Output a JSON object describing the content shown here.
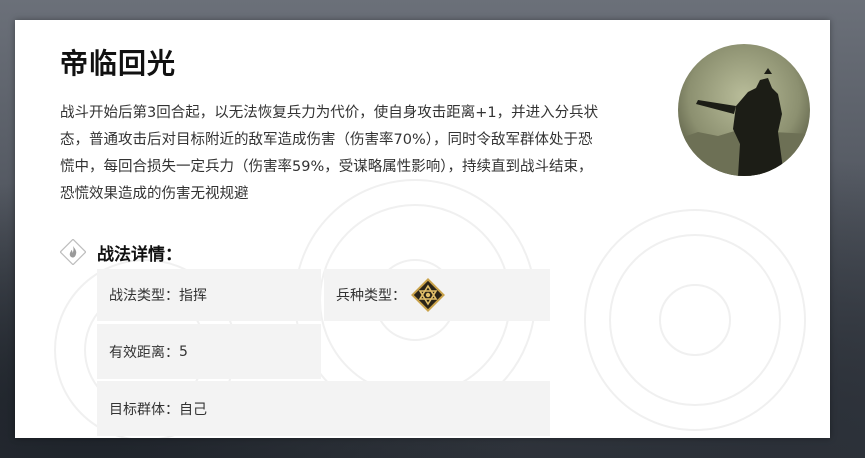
{
  "skill": {
    "name": "帝临回光",
    "description": "战斗开始后第3回合起，以无法恢复兵力为代价，使自身攻击距离+1，并进入分兵状态，普通攻击后对目标附近的敌军造成伤害（伤害率70%），同时令敌军群体处于恐慌中，每回合损失一定兵力（伤害率59%，受谋略属性影响），持续直到战斗结束，恐慌效果造成的伤害无视规避",
    "portrait_icon": "warrior-portrait"
  },
  "details": {
    "heading": "战法详情：",
    "type_label": "战法类型：",
    "type_value": "指挥",
    "troop_label": "兵种类型：",
    "troop_icon": "all-troops-icon",
    "range_label": "有效距离：",
    "range_value": "5",
    "target_label": "目标群体：",
    "target_value": "自己"
  },
  "colors": {
    "card": "#ffffff",
    "cell": "#f3f3f3",
    "text": "#333333",
    "title": "#111111",
    "icon_gold": "#c9a24a"
  }
}
